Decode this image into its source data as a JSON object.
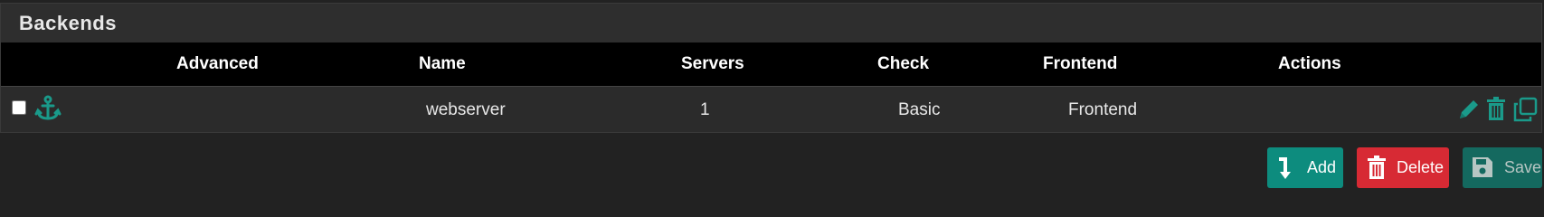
{
  "panel": {
    "title": "Backends"
  },
  "table": {
    "columns": [
      "Advanced",
      "Name",
      "Servers",
      "Check",
      "Frontend",
      "Actions"
    ],
    "rows": [
      {
        "selected": false,
        "advanced_icon": "anchor-icon",
        "name": "webserver",
        "servers": "1",
        "check": "Basic",
        "frontend": "Frontend",
        "actions": [
          "pencil-icon",
          "trash-icon",
          "clone-icon"
        ]
      }
    ]
  },
  "buttons": {
    "add_label": "Add",
    "delete_label": "Delete",
    "save_label": "Save"
  },
  "colors": {
    "accent": "#0d8c7e",
    "icon_teal": "#1a9a8a",
    "danger": "#d72a34",
    "save_disabled": "#14695f",
    "header_bg": "#000000",
    "panel_bg": "#2b2b2b",
    "page_bg": "#222222"
  }
}
